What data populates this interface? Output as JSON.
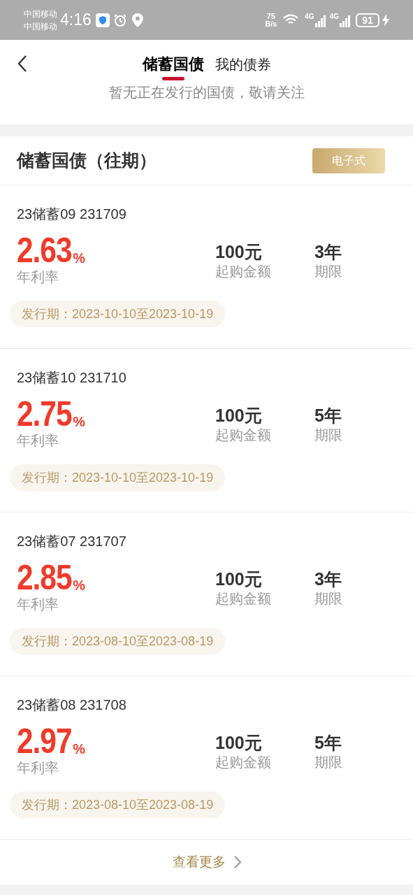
{
  "status_bar": {
    "carriers": [
      "中国移动",
      "中国移动"
    ],
    "time": "4:16",
    "speed_value": "75",
    "speed_unit": "B/s",
    "networks": [
      "4G",
      "4G"
    ],
    "battery": "91"
  },
  "header": {
    "tabs": [
      {
        "label": "储蓄国债",
        "selected": true
      },
      {
        "label": "我的债券",
        "selected": false
      }
    ],
    "notice": "暂无正在发行的国债，敬请关注"
  },
  "section": {
    "title": "储蓄国债（往期）",
    "badge": "电子式"
  },
  "bonds": [
    {
      "name": "23储蓄09 231709",
      "rate": "2.63",
      "rate_unit": "%",
      "rate_label": "年利率",
      "amount": "100元",
      "amount_label": "起购金额",
      "term": "3年",
      "term_label": "期限",
      "period": "发行期：2023-10-10至2023-10-19"
    },
    {
      "name": "23储蓄10 231710",
      "rate": "2.75",
      "rate_unit": "%",
      "rate_label": "年利率",
      "amount": "100元",
      "amount_label": "起购金额",
      "term": "5年",
      "term_label": "期限",
      "period": "发行期：2023-10-10至2023-10-19"
    },
    {
      "name": "23储蓄07 231707",
      "rate": "2.85",
      "rate_unit": "%",
      "rate_label": "年利率",
      "amount": "100元",
      "amount_label": "起购金额",
      "term": "3年",
      "term_label": "期限",
      "period": "发行期：2023-08-10至2023-08-19"
    },
    {
      "name": "23储蓄08 231708",
      "rate": "2.97",
      "rate_unit": "%",
      "rate_label": "年利率",
      "amount": "100元",
      "amount_label": "起购金额",
      "term": "5年",
      "term_label": "期限",
      "period": "发行期：2023-08-10至2023-08-19"
    }
  ],
  "more": {
    "label": "查看更多"
  }
}
